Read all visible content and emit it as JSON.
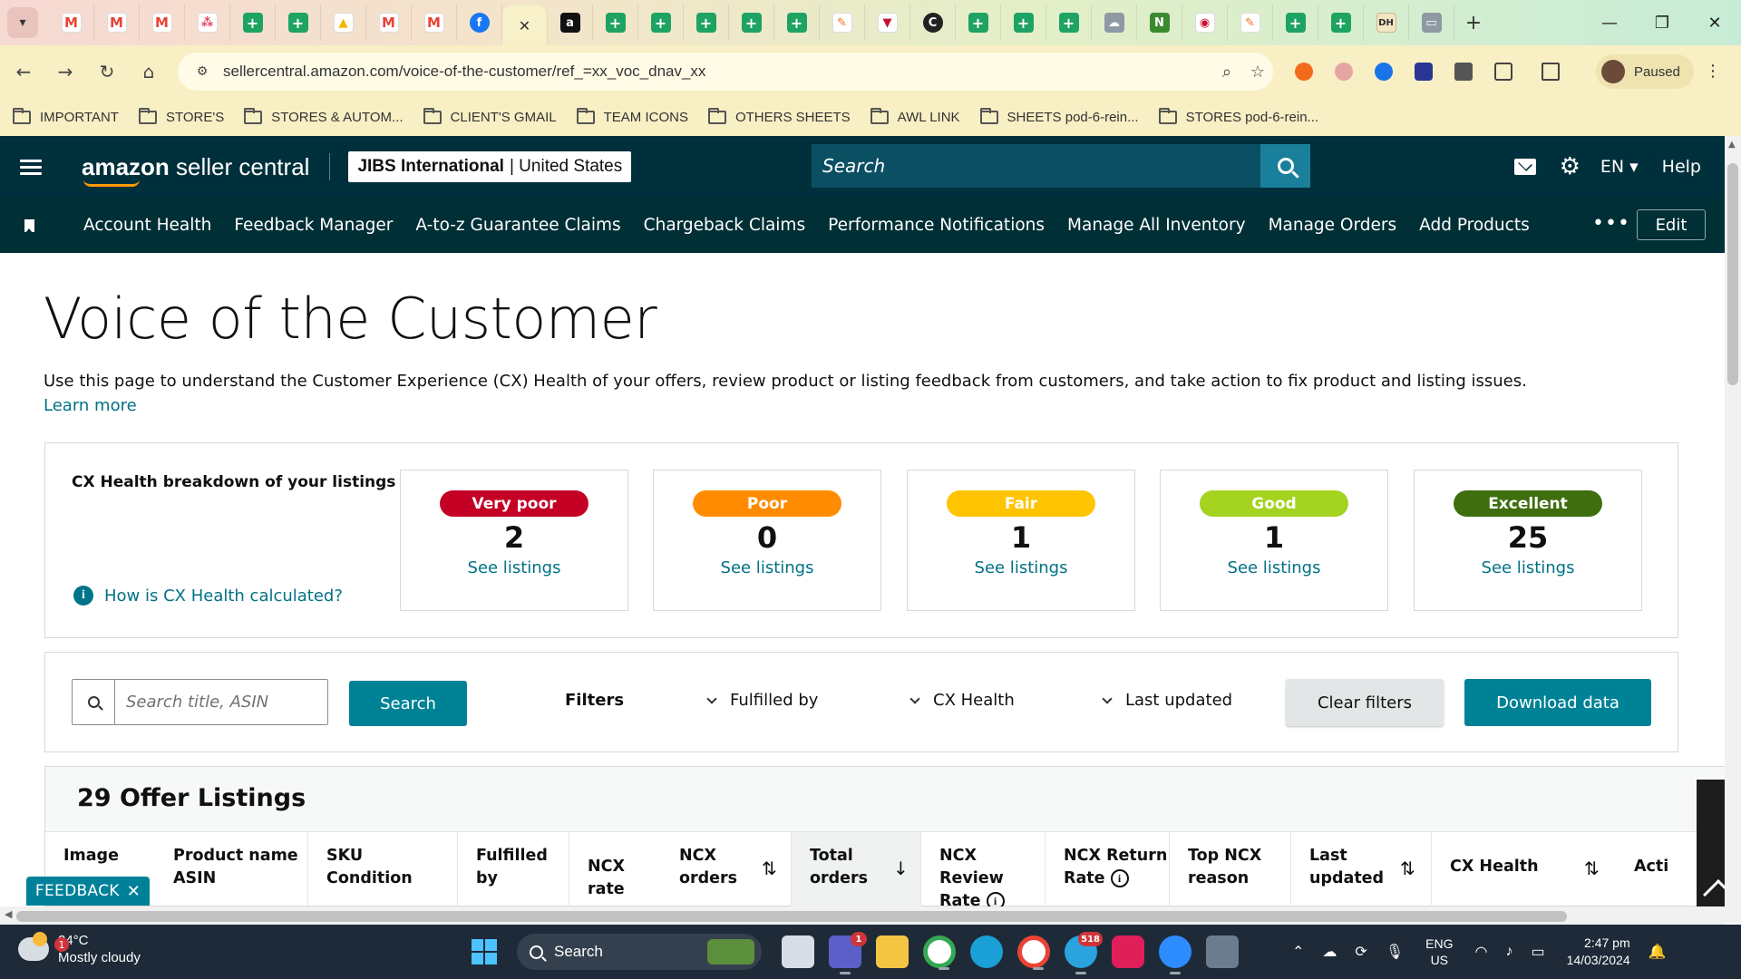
{
  "browser": {
    "tabs": [
      {
        "icon": "gmail-icon",
        "glyph": "M",
        "style": "gmail"
      },
      {
        "icon": "gmail-icon",
        "glyph": "M",
        "style": "gmail"
      },
      {
        "icon": "gmail-icon",
        "glyph": "M",
        "style": "gmail"
      },
      {
        "icon": "asana-icon",
        "glyph": "⁂",
        "style": "dots"
      },
      {
        "icon": "sheets-icon",
        "glyph": "+",
        "style": "sheets"
      },
      {
        "icon": "sheets-icon",
        "glyph": "+",
        "style": "sheets"
      },
      {
        "icon": "drive-icon",
        "glyph": "▲",
        "style": "drive"
      },
      {
        "icon": "gmail-icon",
        "glyph": "M",
        "style": "gmail"
      },
      {
        "icon": "gmail-icon",
        "glyph": "M",
        "style": "gmail"
      },
      {
        "icon": "facebook-icon",
        "glyph": "f",
        "style": "fb"
      },
      {
        "icon": "close-icon",
        "glyph": "✕",
        "style": "active"
      },
      {
        "icon": "amazon-icon",
        "glyph": "a",
        "style": "amazon"
      },
      {
        "icon": "sheets-icon",
        "glyph": "+",
        "style": "sheets"
      },
      {
        "icon": "sheets-icon",
        "glyph": "+",
        "style": "sheets"
      },
      {
        "icon": "sheets-icon",
        "glyph": "+",
        "style": "sheets"
      },
      {
        "icon": "sheets-icon",
        "glyph": "+",
        "style": "sheets"
      },
      {
        "icon": "sheets-icon",
        "glyph": "+",
        "style": "sheets"
      },
      {
        "icon": "tool-icon",
        "glyph": "✎",
        "style": "orange"
      },
      {
        "icon": "shield-icon",
        "glyph": "▼",
        "style": "red"
      },
      {
        "icon": "c-icon",
        "glyph": "C",
        "style": "dark"
      },
      {
        "icon": "sheets-icon",
        "glyph": "+",
        "style": "sheets"
      },
      {
        "icon": "sheets-icon",
        "glyph": "+",
        "style": "sheets"
      },
      {
        "icon": "sheets-icon",
        "glyph": "+",
        "style": "sheets"
      },
      {
        "icon": "cloud-icon",
        "glyph": "☁",
        "style": "grey"
      },
      {
        "icon": "n-icon",
        "glyph": "N",
        "style": "green"
      },
      {
        "icon": "circle-logo-icon",
        "glyph": "◉",
        "style": "red"
      },
      {
        "icon": "tool-icon",
        "glyph": "✎",
        "style": "orange"
      },
      {
        "icon": "sheets-icon",
        "glyph": "+",
        "style": "sheets"
      },
      {
        "icon": "sheets-icon",
        "glyph": "+",
        "style": "sheets"
      },
      {
        "icon": "dh-icon",
        "glyph": "DH",
        "style": "gold"
      },
      {
        "icon": "window-icon",
        "glyph": "▭",
        "style": "grey"
      }
    ],
    "url": "sellercentral.amazon.com/voice-of-the-customer/ref_=xx_voc_dnav_xx",
    "profile_status": "Paused",
    "bookmarks": [
      "IMPORTANT",
      "STORE'S",
      "STORES & AUTOM...",
      "CLIENT'S GMAIL",
      "TEAM ICONS",
      "OTHERS SHEETS",
      "AWL LINK",
      "SHEETS pod-6-rein...",
      "STORES pod-6-rein..."
    ]
  },
  "header": {
    "logo_bold": "amazon",
    "logo_rest": " seller central",
    "account_name": "JIBS International",
    "account_region": "| United States",
    "search_placeholder": "Search",
    "language": "EN ▾",
    "help": "Help"
  },
  "nav": {
    "items": [
      "Account Health",
      "Feedback Manager",
      "A-to-z Guarantee Claims",
      "Chargeback Claims",
      "Performance Notifications",
      "Manage All Inventory",
      "Manage Orders",
      "Add Products"
    ],
    "more": "•••",
    "edit": "Edit"
  },
  "page": {
    "title": "Voice of the Customer",
    "description": "Use this page to understand the Customer Experience (CX) Health of your offers, review product or listing feedback from customers, and take action to fix product and listing issues.",
    "learn_more": "Learn more"
  },
  "cx_health": {
    "heading": "CX Health breakdown of your listings",
    "help_link": "How is CX Health calculated?",
    "cards": [
      {
        "label": "Very poor",
        "count": "2",
        "link": "See listings",
        "color": "#c40025"
      },
      {
        "label": "Poor",
        "count": "0",
        "link": "See listings",
        "color": "#ff8c00"
      },
      {
        "label": "Fair",
        "count": "1",
        "link": "See listings",
        "color": "#ffc400"
      },
      {
        "label": "Good",
        "count": "1",
        "link": "See listings",
        "color": "#a4d320"
      },
      {
        "label": "Excellent",
        "count": "25",
        "link": "See listings",
        "color": "#3f6e0f"
      }
    ]
  },
  "filters": {
    "search_placeholder": "Search title, ASIN",
    "search_button": "Search",
    "label": "Filters",
    "fulfilled_by": "Fulfilled by",
    "cx_health": "CX Health",
    "last_updated": "Last updated",
    "clear": "Clear filters",
    "download": "Download data"
  },
  "listings": {
    "title": "29 Offer Listings",
    "columns": [
      {
        "l1": "Image",
        "l2": ""
      },
      {
        "l1": "Product name",
        "l2": "ASIN"
      },
      {
        "l1": "SKU",
        "l2": "Condition"
      },
      {
        "l1": "Fulfilled",
        "l2": "by"
      },
      {
        "l1": "NCX rate",
        "l2": ""
      },
      {
        "l1": "NCX",
        "l2": "orders"
      },
      {
        "l1": "Total",
        "l2": "orders"
      },
      {
        "l1": "NCX Review",
        "l2": "Rate"
      },
      {
        "l1": "NCX Return",
        "l2": "Rate"
      },
      {
        "l1": "Top NCX",
        "l2": "reason"
      },
      {
        "l1": "Last",
        "l2": "updated"
      },
      {
        "l1": "CX Health",
        "l2": ""
      },
      {
        "l1": "Acti",
        "l2": ""
      }
    ]
  },
  "feedback_tab": "FEEDBACK",
  "taskbar": {
    "temperature": "24°C",
    "weather": "Mostly cloudy",
    "weather_badge": "1",
    "search": "Search",
    "teams_badge": "1",
    "telegram_badge": "518",
    "lang_1": "ENG",
    "lang_2": "US",
    "time": "2:47 pm",
    "date": "14/03/2024"
  }
}
